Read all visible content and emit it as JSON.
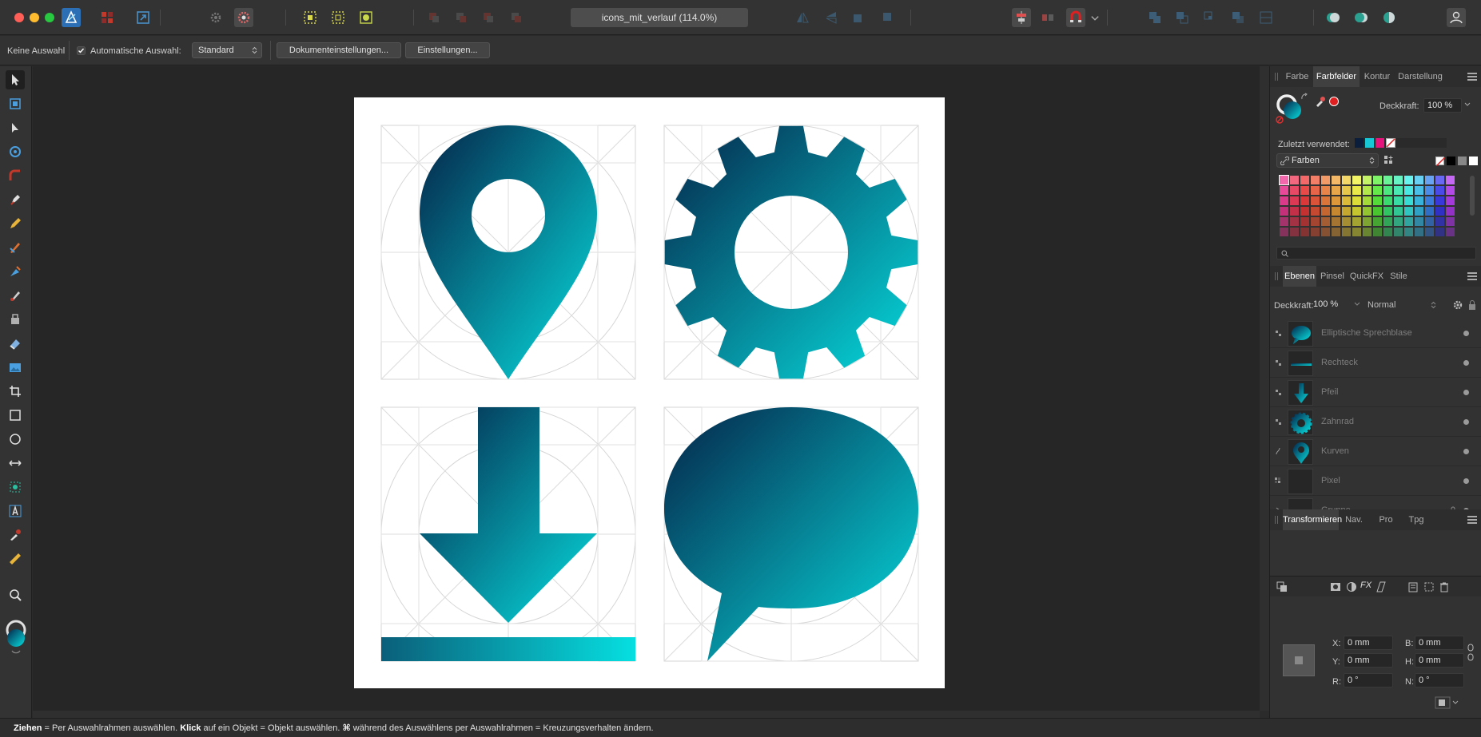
{
  "window": {
    "document_title": "icons_mit_verlauf (114.0%)"
  },
  "context_toolbar": {
    "selection_status": "Keine Auswahl",
    "auto_select_label": "Automatische Auswahl:",
    "auto_select_checked": true,
    "mode_value": "Standard",
    "document_setup_button": "Dokumenteinstellungen...",
    "preferences_button": "Einstellungen..."
  },
  "top_toolbar": {
    "icons": [
      "designer-persona-icon",
      "pixel-persona-icon",
      "export-persona-icon",
      "settings-gear-icon",
      "assistant-icon",
      "select-all-icon",
      "deselect-icon",
      "invert-selection-icon",
      "snapping-icon",
      "account-icon"
    ]
  },
  "left_tools": [
    "move-tool",
    "artboard-tool",
    "node-tool",
    "point-transform-tool",
    "corner-tool",
    "pen-tool",
    "pencil-tool",
    "vector-brush-tool",
    "fill-tool",
    "transparency-tool",
    "paint-brush-tool",
    "erase-tool",
    "place-image-tool",
    "crop-tool",
    "rectangle-tool",
    "ellipse-tool",
    "transform-tool",
    "shape-builder-tool",
    "artistic-text-tool",
    "color-picker-tool",
    "measure-tool",
    "zoom-tool"
  ],
  "color_panel": {
    "tabs": [
      "Farbe",
      "Farbfelder",
      "Kontur",
      "Darstellung"
    ],
    "active_tab": "Farbfelder",
    "opacity_label": "Deckkraft:",
    "opacity_value": "100 %",
    "recent_label": "Zuletzt verwendet:",
    "recent_colors": [
      "#0b1f3d",
      "#18c7d6",
      "#e4147c"
    ],
    "palette_name": "Farben"
  },
  "layers_panel": {
    "tabs": [
      "Ebenen",
      "Pinsel",
      "QuickFX",
      "Stile"
    ],
    "active_tab": "Ebenen",
    "opacity_label": "Deckkraft:",
    "opacity_value": "100 %",
    "blend_mode": "Normal",
    "layers": [
      {
        "name": "Elliptische Sprechblase",
        "thumb": "speech-bubble"
      },
      {
        "name": "Rechteck",
        "thumb": "rectangle"
      },
      {
        "name": "Pfeil",
        "thumb": "arrow"
      },
      {
        "name": "Zahnrad",
        "thumb": "gear"
      },
      {
        "name": "Kurven",
        "thumb": "pin"
      },
      {
        "name": "Pixel",
        "thumb": "empty"
      },
      {
        "name": "Gruppe",
        "thumb": "empty",
        "locked": true
      }
    ]
  },
  "transform_panel": {
    "tabs": [
      "Transformieren",
      "Nav.",
      "Pro",
      "Tpg"
    ],
    "active_tab": "Transformieren",
    "x_label": "X:",
    "x_value": "0 mm",
    "y_label": "Y:",
    "y_value": "0 mm",
    "w_label": "B:",
    "w_value": "0 mm",
    "h_label": "H:",
    "h_value": "0 mm",
    "r_label": "R:",
    "r_value": "0 °",
    "s_label": "N:",
    "s_value": "0 °"
  },
  "artboard": {
    "gradient_start": "#052348",
    "gradient_end": "#06dfe0",
    "icons": [
      "location-pin",
      "gear",
      "download-arrow",
      "speech-bubble"
    ]
  },
  "status": {
    "drag_label": "Ziehen",
    "drag_text": " = Per Auswahlrahmen auswählen. ",
    "click_label": "Klick",
    "click_text": " auf ein Objekt = Objekt auswählen. ",
    "cmd_symbol": "⌘",
    "cmd_text": " während des Auswählens per Auswahlrahmen = Kreuzungsverhalten ändern."
  }
}
